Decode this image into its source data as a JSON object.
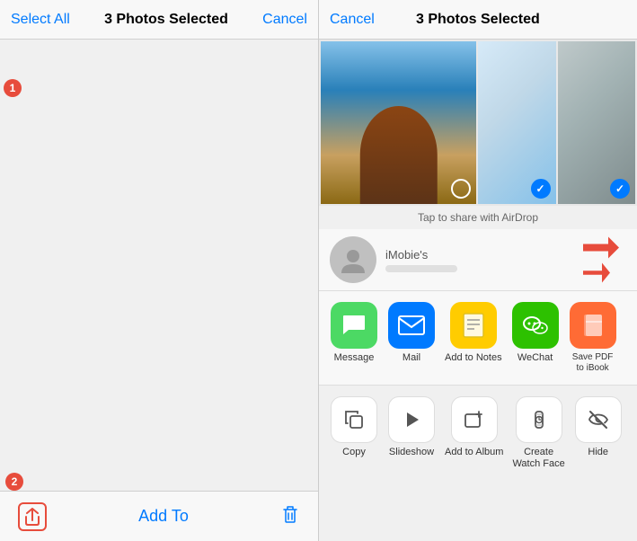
{
  "left_panel": {
    "select_all": "Select All",
    "title": "3 Photos Selected",
    "cancel": "Cancel",
    "badge1": "1",
    "badge2": "2",
    "add_to": "Add To",
    "photos": [
      {
        "id": 1,
        "class": "photo-girl-red",
        "checked": true
      },
      {
        "id": 2,
        "class": "photo-lake",
        "checked": true
      },
      {
        "id": 3,
        "class": "photo-mountain-lake",
        "checked": false
      },
      {
        "id": 4,
        "class": "photo-dark-mountain",
        "checked": false
      },
      {
        "id": 5,
        "class": "photo-dog-white",
        "checked": false
      },
      {
        "id": 6,
        "class": "photo-anime",
        "checked": false
      },
      {
        "id": 7,
        "class": "photo-girl-face",
        "checked": false
      },
      {
        "id": 8,
        "class": "photo-husky",
        "checked": false
      },
      {
        "id": 9,
        "class": "photo-brown-dog",
        "checked": false
      },
      {
        "id": 10,
        "class": "photo-golden-dog",
        "checked": false
      },
      {
        "id": 11,
        "class": "photo-puppy",
        "checked": false
      },
      {
        "id": 12,
        "class": "photo-little-girl",
        "checked": false
      }
    ]
  },
  "right_panel": {
    "cancel": "Cancel",
    "title": "3 Photos Selected",
    "airdrop_hint": "Tap to share with AirDrop",
    "contact_name": "iMobie's",
    "share_items": [
      {
        "label": "Message",
        "icon": "💬",
        "color_class": "green"
      },
      {
        "label": "Mail",
        "icon": "✉️",
        "color_class": "blue"
      },
      {
        "label": "Add to Notes",
        "icon": "📝",
        "color_class": "yellow"
      },
      {
        "label": "WeChat",
        "icon": "💬",
        "color_class": "wechat"
      },
      {
        "label": "Save PDF\nto iBook",
        "icon": "📖",
        "color_class": "orange"
      }
    ],
    "action_items": [
      {
        "label": "Copy",
        "icon": "⧉"
      },
      {
        "label": "Slideshow",
        "icon": "▶"
      },
      {
        "label": "Add to Album",
        "icon": "➕"
      },
      {
        "label": "Create\nWatch Face",
        "icon": "⌚"
      },
      {
        "label": "Hide",
        "icon": "🚫"
      }
    ]
  }
}
